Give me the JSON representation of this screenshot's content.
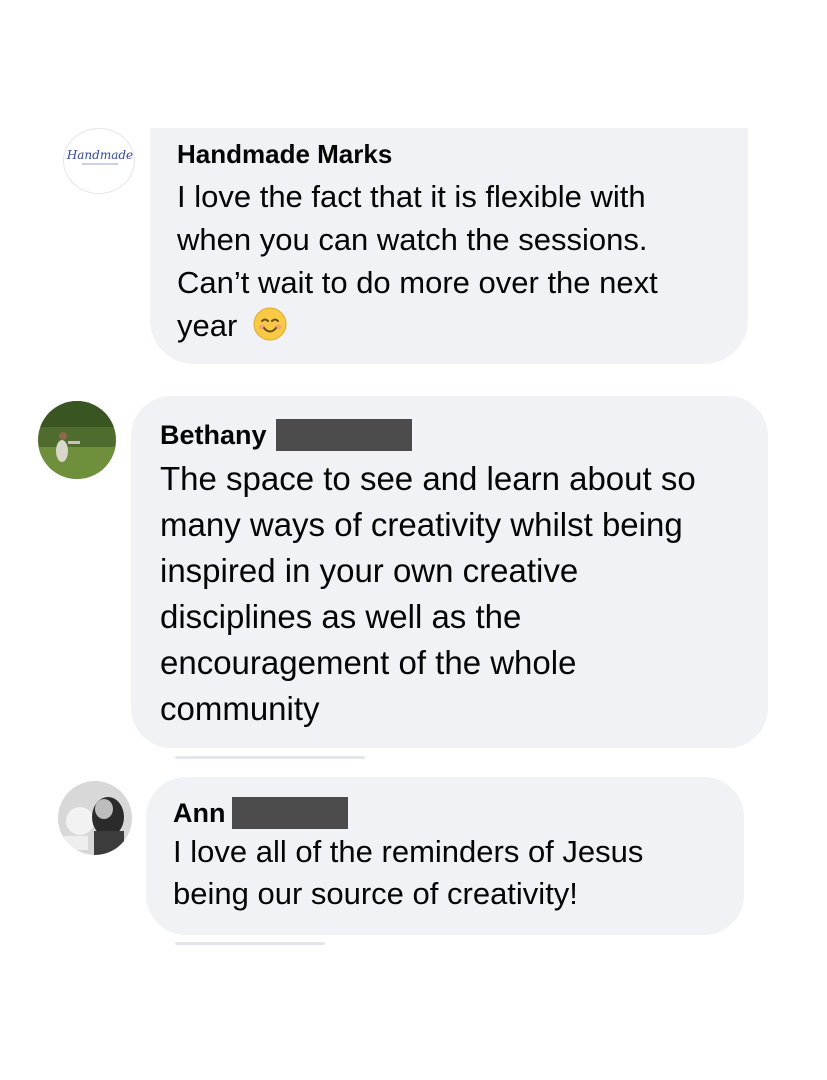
{
  "comments": [
    {
      "author": "Handmade Marks",
      "avatar_logo_text": "Handmade",
      "avatar_icon": "brand-logo-icon",
      "text": "I love the fact that it is flexible with when you can watch the sessions. Can’t wait to do more over the next year",
      "trailing_emoji": "smiling-face-icon",
      "surname_redacted": false
    },
    {
      "author": "Bethany",
      "avatar_icon": "profile-photo-icon",
      "text": "The space to see and learn about so many ways of creativity whilst being inspired in your own creative disciplines as well as the encouragement of the whole community",
      "surname_redacted": true
    },
    {
      "author": "Ann",
      "avatar_icon": "profile-photo-icon",
      "text": "I love all of the reminders of Jesus being our source of creativity!",
      "surname_redacted": true
    }
  ],
  "colors": {
    "bubble": "#f0f2f5",
    "text": "#050505",
    "redaction": "#4b4b4b",
    "logo": "#2f4a9c"
  }
}
